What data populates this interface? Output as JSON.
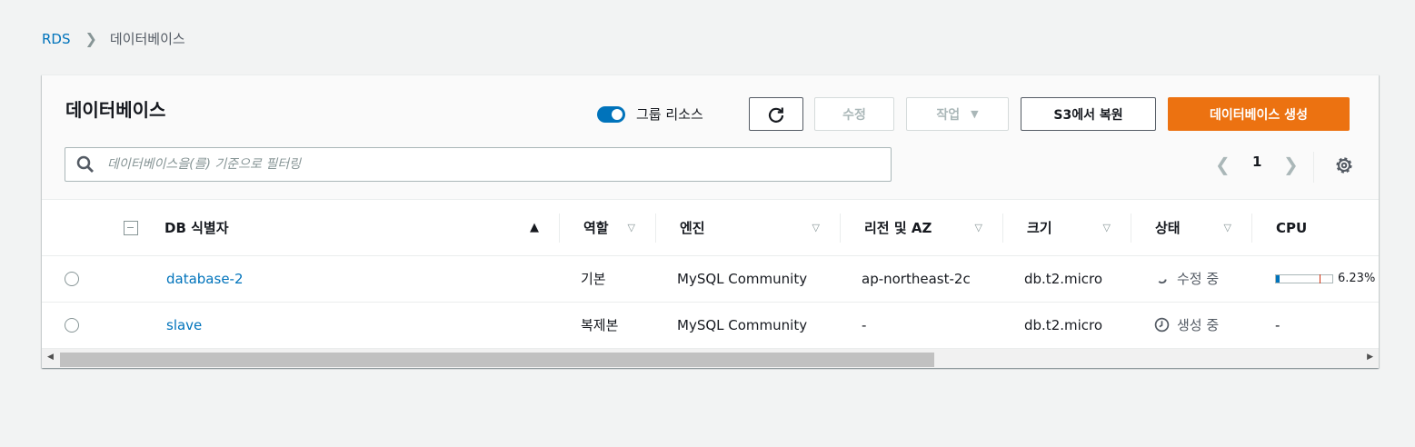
{
  "breadcrumb": {
    "root": "RDS",
    "current": "데이터베이스"
  },
  "panel": {
    "title": "데이터베이스",
    "group_toggle_label": "그룹 리소스",
    "group_toggle_on": true,
    "buttons": {
      "modify": "수정",
      "actions": "작업",
      "restore_s3": "S3에서 복원",
      "create": "데이터베이스 생성"
    },
    "search_placeholder": "데이터베이스을(를) 기준으로 필터링",
    "page": "1"
  },
  "table": {
    "columns": [
      "DB 식별자",
      "역할",
      "엔진",
      "리전 및 AZ",
      "크기",
      "상태",
      "CPU"
    ],
    "rows": [
      {
        "id": "database-2",
        "role": "기본",
        "engine": "MySQL Community",
        "region": "ap-northeast-2c",
        "size": "db.t2.micro",
        "status": "수정 중",
        "cpu": "6.23%",
        "cpu_value": 0.0623
      },
      {
        "id": "slave",
        "role": "복제본",
        "engine": "MySQL Community",
        "region": "-",
        "size": "db.t2.micro",
        "status": "생성 중",
        "cpu": "-"
      }
    ]
  },
  "colors": {
    "primary": "#ec7211",
    "link": "#0073bb",
    "toggle": "#0073bb"
  }
}
